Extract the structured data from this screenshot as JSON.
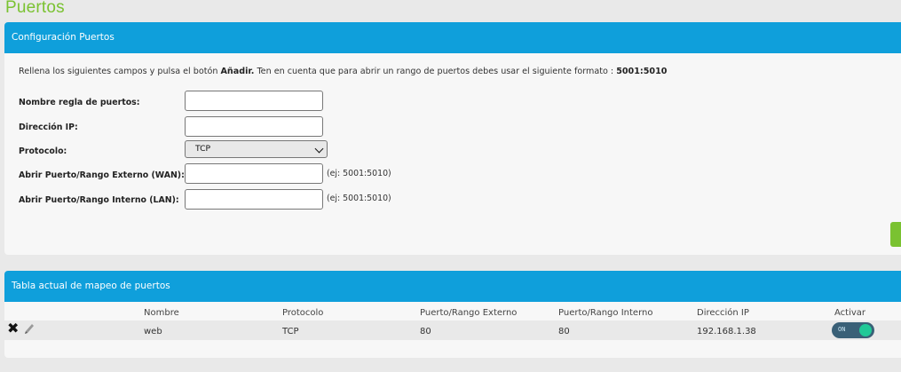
{
  "page": {
    "title": "Puertos"
  },
  "config": {
    "header": "Configuración Puertos",
    "instructions": {
      "part1": "Rellena los siguientes campos y pulsa el botón ",
      "button_name": "Añadir.",
      "part2": " Ten en cuenta que para abrir un rango de puertos debes usar el siguiente formato : ",
      "format": "5001:5010"
    },
    "fields": {
      "rule_name": {
        "label": "Nombre regla de puertos:",
        "value": ""
      },
      "ip": {
        "label": "Dirección IP:",
        "value": ""
      },
      "protocol": {
        "label": "Protocolo:",
        "value": "TCP"
      },
      "external": {
        "label": "Abrir Puerto/Rango Externo (WAN):",
        "value": "",
        "hint": "(ej: 5001:5010)"
      },
      "internal": {
        "label": "Abrir Puerto/Rango Interno (LAN):",
        "value": "",
        "hint": "(ej: 5001:5010)"
      }
    },
    "add_button_color": "#7ac231"
  },
  "table": {
    "header": "Tabla actual de mapeo de puertos",
    "columns": [
      "Nombre",
      "Protocolo",
      "Puerto/Rango Externo",
      "Puerto/Rango Interno",
      "Dirección IP",
      "Activar"
    ],
    "rows": [
      {
        "nombre": "web",
        "protocolo": "TCP",
        "externo": "80",
        "interno": "80",
        "ip": "192.168.1.38",
        "activar": "ON"
      }
    ]
  },
  "colors": {
    "accent": "#0f9fdb",
    "brand_green": "#7ac231",
    "toggle_on": "#20c997"
  }
}
